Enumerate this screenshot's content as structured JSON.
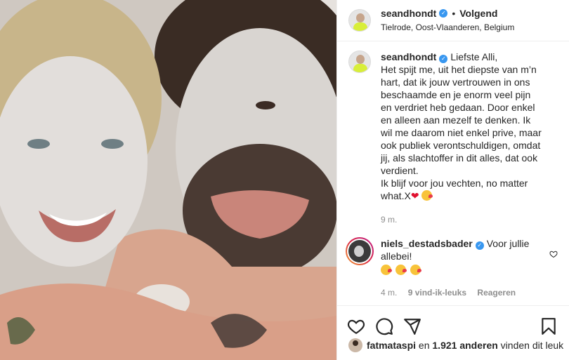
{
  "post": {
    "author": "seandhondt",
    "follow_label": "Volgend",
    "location": "Tielrode, Oost-Vlaanderen, Belgium",
    "caption_lines": [
      "Liefste Alli,",
      "Het spijt me, uit het diepste van m’n hart, dat ik jouw vertrouwen in ons beschaamde en je enorm veel pijn en verdriet heb gedaan. Door enkel en alleen aan mezelf te denken. Ik wil me daarom niet enkel prive, maar ook publiek verontschuldigen, omdat jij, als slachtoffer in dit alles, dat ook verdient.",
      "Ik blijf voor jou vechten, no matter what.X"
    ],
    "caption_time": "9 m.",
    "brand_color": "#3897f0"
  },
  "comment": {
    "author": "niels_destadsbader",
    "text": "Voor jullie allebei!",
    "time": "4 m.",
    "likes": "9 vind-ik-leuks",
    "reply_label": "Reageren"
  },
  "footer": {
    "liker": "fatmataspi",
    "likes_middle": "en",
    "likes_count": "1.921 anderen",
    "likes_suffix": "vinden dit leuk"
  },
  "icons": [
    "verified-icon",
    "heart-icon",
    "comment-icon",
    "share-icon",
    "bookmark-icon"
  ]
}
